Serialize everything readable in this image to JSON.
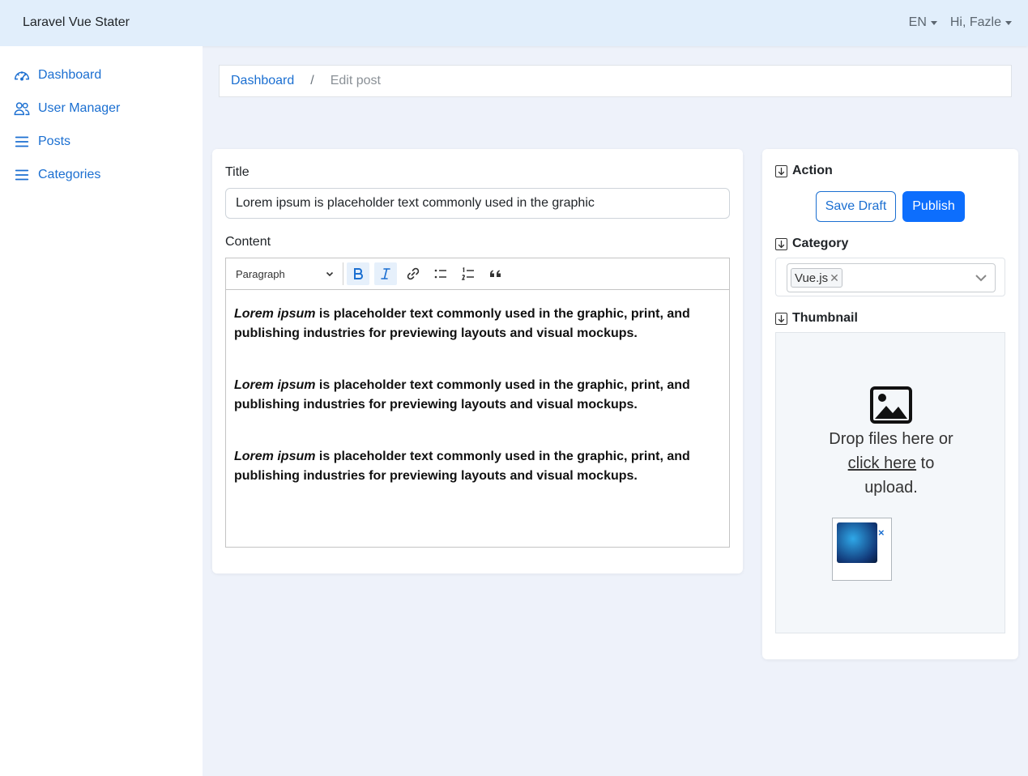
{
  "app": {
    "brand": "Laravel Vue Stater"
  },
  "topbar": {
    "language": "EN",
    "user_greeting": "Hi, Fazle"
  },
  "sidebar": {
    "items": [
      {
        "label": "Dashboard",
        "icon": "speedometer-icon"
      },
      {
        "label": "User Manager",
        "icon": "users-icon"
      },
      {
        "label": "Posts",
        "icon": "list-icon"
      },
      {
        "label": "Categories",
        "icon": "list-icon"
      }
    ]
  },
  "breadcrumb": {
    "home": "Dashboard",
    "separator": "/",
    "current": "Edit post"
  },
  "form": {
    "title_label": "Title",
    "title_value": "Lorem ipsum is placeholder text commonly used in the graphic",
    "content_label": "Content",
    "toolbar": {
      "paragraph_format": "Paragraph"
    },
    "content_paragraphs": [
      {
        "italic": "Lorem ipsum",
        "rest": " is placeholder text commonly used in the graphic, print, and publishing industries for previewing layouts and visual mockups."
      },
      {
        "italic": "Lorem ipsum",
        "rest": " is placeholder text commonly used in the graphic, print, and publishing industries for previewing layouts and visual mockups."
      },
      {
        "italic": "Lorem ipsum",
        "rest": " is placeholder text commonly used in the graphic, print, and publishing industries for previewing layouts and visual mockups."
      }
    ]
  },
  "side": {
    "action_heading": "Action",
    "save_draft_label": "Save Draft",
    "publish_label": "Publish",
    "category_heading": "Category",
    "selected_category": "Vue.js",
    "thumbnail_heading": "Thumbnail",
    "dropzone": {
      "text_before": "Drop files here or",
      "link_text": "click here",
      "text_after": "to upload."
    },
    "thumb_remove": "×"
  },
  "colors": {
    "accent": "#1b6fd1",
    "primary_button": "#0d6efd",
    "topbar_bg": "#e1eefb",
    "page_bg": "#eef2fa"
  }
}
